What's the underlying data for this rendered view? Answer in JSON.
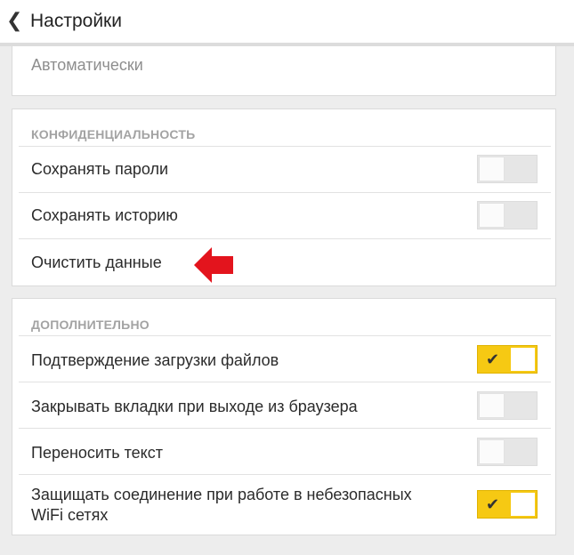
{
  "header": {
    "back_icon": "chevron-left-icon",
    "back_glyph": "❮",
    "title": "Настройки"
  },
  "top_card": {
    "value": "Автоматически"
  },
  "privacy": {
    "heading": "КОНФИДЕНЦИАЛЬНОСТЬ",
    "items": [
      {
        "label": "Сохранять пароли",
        "toggle": "off"
      },
      {
        "label": "Сохранять историю",
        "toggle": "off"
      },
      {
        "label": "Очистить данные"
      }
    ]
  },
  "additional": {
    "heading": "ДОПОЛНИТЕЛЬНО",
    "items": [
      {
        "label": "Подтверждение загрузки файлов",
        "toggle": "on"
      },
      {
        "label": "Закрывать вкладки при выходе из браузера",
        "toggle": "off"
      },
      {
        "label": "Переносить текст",
        "toggle": "off"
      },
      {
        "label_line1": "Защищать соединение при работе в небезопасных",
        "label_line2": "WiFi сетях",
        "toggle": "on"
      }
    ]
  },
  "toggle_check_glyph": "✔",
  "colors": {
    "toggle_on": "#f6c913",
    "toggle_off": "#e6e6e6",
    "arrow": "#e3141d"
  },
  "annotation": {
    "icon": "red-arrow-left-icon"
  }
}
